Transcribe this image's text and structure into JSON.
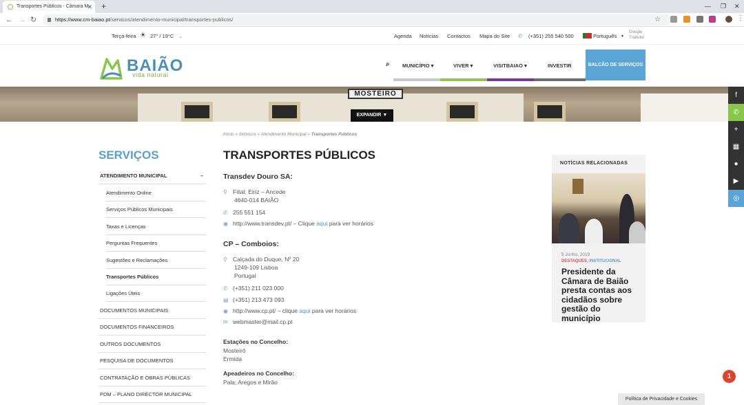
{
  "browser": {
    "tab_title": "Transportes Públicos - Câmara M",
    "url_prefix": "https://www.cm-baiao.pt",
    "url_path": "/servicos/atendimento-municipal/transportes-publicos/"
  },
  "topstrip": {
    "day": "Terça-feira",
    "weather": "27° / 19°C",
    "links": [
      "Agenda",
      "Notícias",
      "Contactos",
      "Mapa do Site"
    ],
    "phone": "(+351) 255 540 500",
    "language": "Português",
    "translator_line1": "Google",
    "translator_line2": "Tradutor"
  },
  "logo": {
    "name": "BAIÃO",
    "tagline": "vida natural"
  },
  "nav": {
    "items": [
      "MUNICÍPIO",
      "VIVER",
      "VISITBAIAO",
      "INVESTIR"
    ],
    "cta": "BALCÃO DE SERVIÇOS",
    "colors": [
      "#c8c8c8",
      "#9bbf5a",
      "#7a3a8a",
      "#6d6d6d"
    ]
  },
  "hero": {
    "sign": "MOSTEIRO",
    "expand": "EXPANDIR ▼"
  },
  "sidebar": {
    "title": "SERVIÇOS",
    "section": "ATENDIMENTO MUNICIPAL",
    "section_toggle": "–",
    "subitems": [
      "Atendimento Online",
      "Serviços Públicos Municipais",
      "Taxas e Licenças",
      "Perguntas Frequentes",
      "Sugestões e Reclamações",
      "Transportes Públicos",
      "Ligações Úteis"
    ],
    "items": [
      "DOCUMENTOS MUNICIPAIS",
      "DOCUMENTOS FINANCEIROS",
      "OUTROS DOCUMENTOS",
      "PESQUISA DE DOCUMENTOS",
      "CONTRATAÇÃO E OBRAS PÚBLICAS",
      "PDM – PLANO DIRECTOR MUNICIPAL"
    ]
  },
  "breadcrumb": {
    "home": "Início",
    "level1": "Serviços",
    "level2": "Atendimento Municipal",
    "current": "Transportes Públicos",
    "sep": "»"
  },
  "main": {
    "title": "TRANSPORTES PÚBLICOS",
    "transdev": {
      "heading": "Transdev Douro SA:",
      "address1": "Filial: Eiriz – Ancede",
      "address2": "4640-014 BAIÃO",
      "phone": "255 551 154",
      "web_text": "http://www.transdev.pt/ – Clique",
      "web_link": "aqui",
      "web_suffix": "para ver horários"
    },
    "cp": {
      "heading": "CP – Comboios:",
      "address1": "Calçada do Duque, Nº 20",
      "address2": "1249-109 Lisboa",
      "address3": "Portugal",
      "phone": "(+351) 211 023 000",
      "fax": "(+351) 213 473 093",
      "web_text": "http://www.cp.pt/ – clique",
      "web_link": "aqui",
      "web_suffix": "para ver horários",
      "email": "webmaster@mail.cp.pt"
    },
    "estacoes_label": "Estações no Concelho:",
    "estacoes": [
      "Mosteirô",
      "Ermida"
    ],
    "apeadeiros_label": "Apeadeiros no Concelho:",
    "apeadeiros": "Pala; Aregos e Mirão"
  },
  "news": {
    "heading": "NOTÍCIAS RELACIONADAS",
    "date": "5 Junho, 2019",
    "tag1": "DESTAQUES,",
    "tag2": "INSTITUCIONAL",
    "title": "Presidente da Câmara de Baião presta contas aos cidadãos sobre gestão do município"
  },
  "cookie": "Política de Privacidade e Cookies",
  "alert_badge": "1",
  "colors": {
    "accent": "#5aa5d6",
    "brand_green": "#8ac64a",
    "title_blue": "#5a9fc8"
  }
}
